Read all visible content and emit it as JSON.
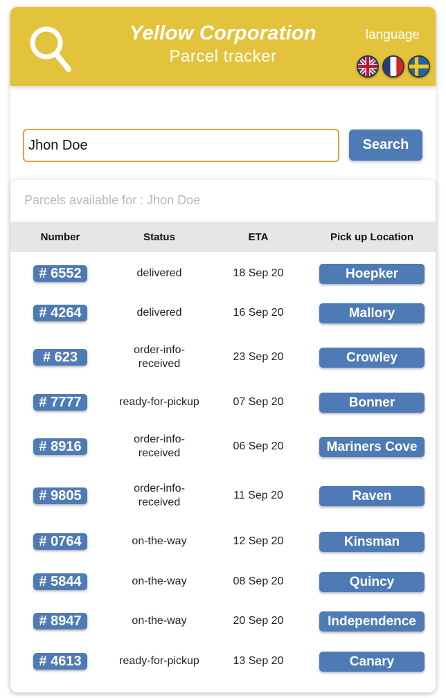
{
  "header": {
    "company": "Yellow Corporation",
    "subtitle": "Parcel tracker",
    "language_label": "language",
    "flags": [
      "uk-flag-icon",
      "france-flag-icon",
      "sweden-flag-icon"
    ]
  },
  "search": {
    "value": "Jhon Doe",
    "button_label": "Search"
  },
  "results": {
    "caption": "Parcels available for : Jhon Doe",
    "columns": [
      "Number",
      "Status",
      "ETA",
      "Pick up Location"
    ],
    "rows": [
      {
        "number": "# 6552",
        "status": "delivered",
        "eta": "18 Sep 20",
        "location": "Hoepker"
      },
      {
        "number": "# 4264",
        "status": "delivered",
        "eta": "16 Sep 20",
        "location": "Mallory"
      },
      {
        "number": "# 623",
        "status": "order-info-received",
        "eta": "23 Sep 20",
        "location": "Crowley"
      },
      {
        "number": "# 7777",
        "status": "ready-for-pickup",
        "eta": "07 Sep 20",
        "location": "Bonner"
      },
      {
        "number": "# 8916",
        "status": "order-info-received",
        "eta": "06 Sep 20",
        "location": "Mariners Cove"
      },
      {
        "number": "# 9805",
        "status": "order-info-received",
        "eta": "11 Sep 20",
        "location": "Raven"
      },
      {
        "number": "# 0764",
        "status": "on-the-way",
        "eta": "12 Sep 20",
        "location": "Kinsman"
      },
      {
        "number": "# 5844",
        "status": "on-the-way",
        "eta": "08 Sep 20",
        "location": "Quincy"
      },
      {
        "number": "# 8947",
        "status": "on-the-way",
        "eta": "20 Sep 20",
        "location": "Independence"
      },
      {
        "number": "# 4613",
        "status": "ready-for-pickup",
        "eta": "13 Sep 20",
        "location": "Canary"
      }
    ]
  },
  "colors": {
    "header_bg": "#e3c33b",
    "accent_blue": "#4e7bb5",
    "input_border": "#e4a13a"
  }
}
